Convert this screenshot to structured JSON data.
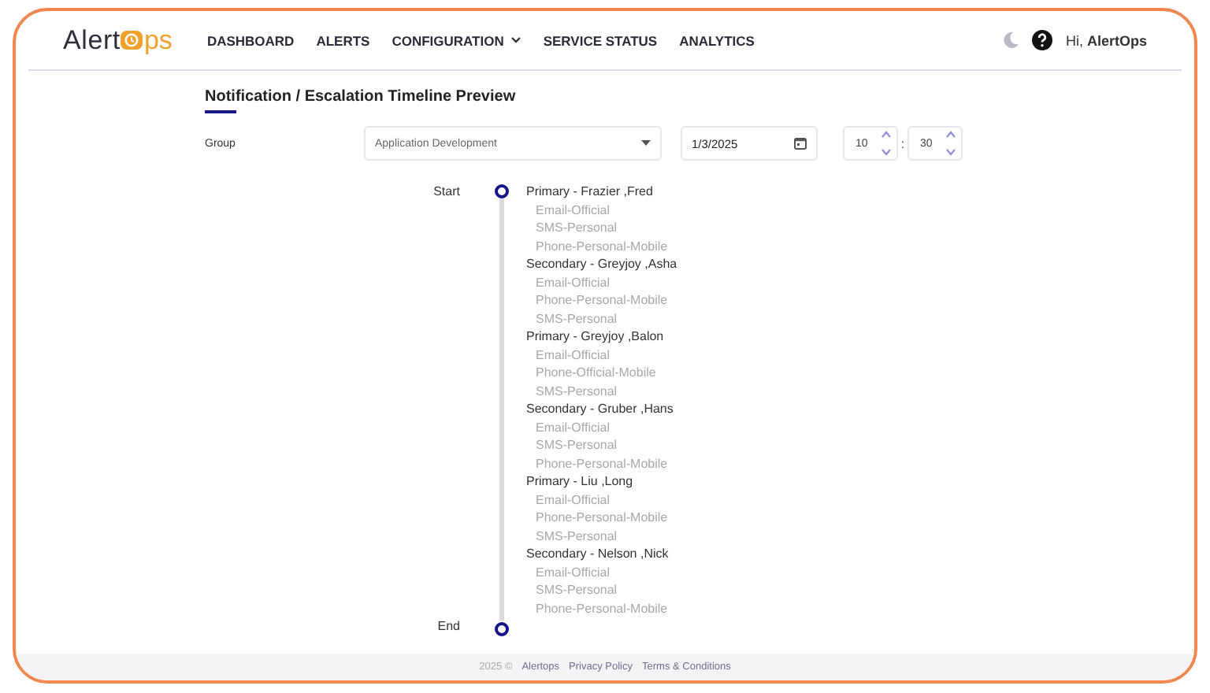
{
  "logo": {
    "left": "Alert",
    "right": "ps"
  },
  "nav": [
    {
      "label": "DASHBOARD",
      "dropdown": false
    },
    {
      "label": "ALERTS",
      "dropdown": false
    },
    {
      "label": "CONFIGURATION",
      "dropdown": true
    },
    {
      "label": "SERVICE STATUS",
      "dropdown": false
    },
    {
      "label": "ANALYTICS",
      "dropdown": false
    }
  ],
  "greeting": {
    "prefix": "Hi,",
    "name": "AlertOps"
  },
  "page_title": "Notification / Escalation Timeline Preview",
  "form": {
    "group_label": "Group",
    "group_value": "Application Development",
    "date": "1/3/2025",
    "hour": "10",
    "separator": ":",
    "minute": "30"
  },
  "timeline": {
    "start_label": "Start",
    "end_label": "End",
    "steps": [
      {
        "title": "Primary - Frazier ,Fred",
        "methods": [
          "Email-Official",
          "SMS-Personal",
          "Phone-Personal-Mobile"
        ]
      },
      {
        "title": "Secondary - Greyjoy ,Asha",
        "methods": [
          "Email-Official",
          "Phone-Personal-Mobile",
          "SMS-Personal"
        ]
      },
      {
        "title": "Primary - Greyjoy ,Balon",
        "methods": [
          "Email-Official",
          "Phone-Official-Mobile",
          "SMS-Personal"
        ]
      },
      {
        "title": "Secondary - Gruber ,Hans",
        "methods": [
          "Email-Official",
          "SMS-Personal",
          "Phone-Personal-Mobile"
        ]
      },
      {
        "title": "Primary - Liu ,Long",
        "methods": [
          "Email-Official",
          "Phone-Personal-Mobile",
          "SMS-Personal"
        ]
      },
      {
        "title": "Secondary - Nelson ,Nick",
        "methods": [
          "Email-Official",
          "SMS-Personal",
          "Phone-Personal-Mobile"
        ]
      }
    ]
  },
  "footer": {
    "copyright": "2025 ©",
    "links": [
      "Alertops",
      "Privacy Policy",
      "Terms & Conditions"
    ]
  }
}
